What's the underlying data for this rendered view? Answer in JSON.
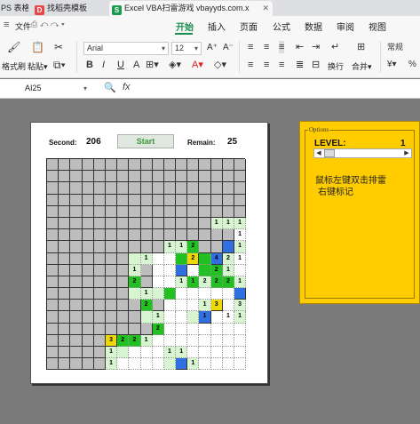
{
  "tabs": [
    {
      "label": "PS 表格",
      "icon": "",
      "active": false
    },
    {
      "label": "找稻壳模板",
      "icon": "docer-icon",
      "active": false
    },
    {
      "label": "Excel VBA扫雷游戏 vbayyds.com.x",
      "icon": "S",
      "active": true
    }
  ],
  "menu": {
    "file": "文件",
    "items": [
      "开始",
      "插入",
      "页面",
      "公式",
      "数据",
      "审阅",
      "视图"
    ],
    "active": "开始"
  },
  "ribbon": {
    "format_painter": "格式刷",
    "paste": "粘贴",
    "font": "Arial",
    "font_size": "12",
    "bold": "B",
    "italic": "I",
    "underline": "U",
    "wrap": "换行",
    "merge": "合并",
    "number_format": "常规"
  },
  "formula_bar": {
    "name_box": "AI25",
    "fx": "fx"
  },
  "game": {
    "second_label": "Second:",
    "second_value": "206",
    "start_label": "Start",
    "remain_label": "Remain:",
    "remain_value": "25",
    "board": [
      "uuuuuuuuuuuuuuuuu",
      "uuuuuuuuuuuuuuuuu",
      "uuuuuuuuuuuuuuuuu",
      "uuuuuuuuuuuuuuuuu",
      "uuuuuuuuuuuuuuuuu",
      "uuuuuuuuuuuuuuggg",
      "uuuuuuuuuuuuuuuuo",
      "uuuuuuuuuuggGuubg",
      "uuuuuuuggooGyGbgo",
      "uuuuuuuguooboGGgo",
      "uuuuuuuGuoogGgGGg",
      "uuuuuuugggGooooob",
      "uuuuuuuuGuooogyog",
      "uuuuuuuuggoogboog",
      "uuuuuuuuuGooooooo",
      "uuuuuyGGgoooooooo",
      "uuuuuggoooggooooo",
      "uuuuugoooogbgoooo"
    ],
    "numbers": [
      [
        "",
        "",
        "",
        "",
        "",
        "",
        "",
        "",
        "",
        "",
        "",
        "",
        "",
        "",
        "",
        "",
        ""
      ],
      [
        "",
        "",
        "",
        "",
        "",
        "",
        "",
        "",
        "",
        "",
        "",
        "",
        "",
        "",
        "",
        "",
        ""
      ],
      [
        "",
        "",
        "",
        "",
        "",
        "",
        "",
        "",
        "",
        "",
        "",
        "",
        "",
        "",
        "",
        "",
        ""
      ],
      [
        "",
        "",
        "",
        "",
        "",
        "",
        "",
        "",
        "",
        "",
        "",
        "",
        "",
        "",
        "",
        "",
        ""
      ],
      [
        "",
        "",
        "",
        "",
        "",
        "",
        "",
        "",
        "",
        "",
        "",
        "",
        "",
        "",
        "",
        "",
        ""
      ],
      [
        "",
        "",
        "",
        "",
        "",
        "",
        "",
        "",
        "",
        "",
        "",
        "",
        "",
        "",
        "1",
        "1",
        "1"
      ],
      [
        "",
        "",
        "",
        "",
        "",
        "",
        "",
        "",
        "",
        "",
        "",
        "",
        "",
        "",
        "",
        "",
        "1"
      ],
      [
        "",
        "",
        "",
        "",
        "",
        "",
        "",
        "",
        "",
        "",
        "1",
        "1",
        "2",
        "",
        "",
        "",
        "1"
      ],
      [
        "",
        "",
        "",
        "",
        "",
        "",
        "",
        "",
        "1",
        "",
        "",
        "",
        "2",
        "",
        "4",
        "2",
        "1"
      ],
      [
        "",
        "",
        "",
        "",
        "",
        "",
        "",
        "1",
        "",
        "",
        "",
        "",
        "",
        "",
        "2",
        "1",
        ""
      ],
      [
        "",
        "",
        "",
        "",
        "",
        "",
        "",
        "2",
        "",
        "",
        "",
        "1",
        "1",
        "2",
        "2",
        "2",
        "1"
      ],
      [
        "",
        "",
        "",
        "",
        "",
        "",
        "",
        "",
        "1",
        "",
        "",
        "",
        "",
        "",
        "",
        "",
        ""
      ],
      [
        "",
        "",
        "",
        "",
        "",
        "",
        "",
        "",
        "2",
        "",
        "",
        "",
        "",
        "1",
        "3",
        "",
        "3"
      ],
      [
        "",
        "",
        "",
        "",
        "",
        "",
        "",
        "",
        "",
        "1",
        "",
        "",
        "",
        "1",
        "",
        "1",
        "1"
      ],
      [
        "",
        "",
        "",
        "",
        "",
        "",
        "",
        "",
        "",
        "2",
        "",
        "",
        "",
        "",
        "",
        "",
        ""
      ],
      [
        "",
        "",
        "",
        "",
        "",
        "3",
        "2",
        "2",
        "1",
        "",
        "",
        "",
        "",
        "",
        "",
        "",
        ""
      ],
      [
        "",
        "",
        "",
        "",
        "",
        "1",
        "",
        "",
        "",
        "",
        "1",
        "1",
        "",
        "",
        "",
        "",
        ""
      ],
      [
        "",
        "",
        "",
        "",
        "",
        "1",
        "",
        "",
        "",
        "",
        "",
        "",
        "1",
        "",
        "",
        "",
        ""
      ]
    ]
  },
  "options": {
    "title": "Options",
    "level_label": "LEVEL:",
    "level_value": "1",
    "level": 1,
    "hint_line1": "鼠标左键双击排雷",
    "hint_line2": "右键标记"
  }
}
